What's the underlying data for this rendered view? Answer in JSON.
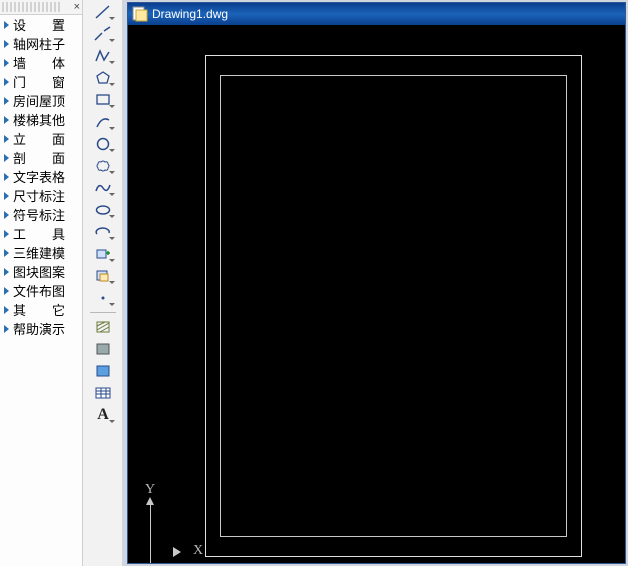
{
  "panel": {
    "items": [
      {
        "label": "设　　置"
      },
      {
        "label": "轴网柱子"
      },
      {
        "label": "墙　　体"
      },
      {
        "label": "门　　窗"
      },
      {
        "label": "房间屋顶"
      },
      {
        "label": "楼梯其他"
      },
      {
        "label": "立　　面"
      },
      {
        "label": "剖　　面"
      },
      {
        "label": "文字表格"
      },
      {
        "label": "尺寸标注"
      },
      {
        "label": "符号标注"
      },
      {
        "label": "工　　具"
      },
      {
        "label": "三维建模"
      },
      {
        "label": "图块图案"
      },
      {
        "label": "文件布图"
      },
      {
        "label": "其　　它"
      },
      {
        "label": "帮助演示"
      }
    ]
  },
  "toolbar": {
    "tools": [
      {
        "name": "line-tool",
        "drop": true
      },
      {
        "name": "construction-line-tool",
        "drop": true
      },
      {
        "name": "polyline-tool",
        "drop": true
      },
      {
        "name": "polygon-tool",
        "drop": true
      },
      {
        "name": "rectangle-tool",
        "drop": true
      },
      {
        "name": "arc-tool",
        "drop": true
      },
      {
        "name": "circle-tool",
        "drop": true
      },
      {
        "name": "revision-cloud-tool",
        "drop": true
      },
      {
        "name": "spline-tool",
        "drop": true
      },
      {
        "name": "ellipse-tool",
        "drop": true
      },
      {
        "name": "ellipse-arc-tool",
        "drop": true
      },
      {
        "name": "insert-block-tool",
        "drop": true
      },
      {
        "name": "make-block-tool",
        "drop": true
      },
      {
        "name": "point-tool",
        "drop": true
      },
      {
        "name": "hatch-tool",
        "drop": false
      },
      {
        "name": "gradient-tool",
        "drop": false
      },
      {
        "name": "region-tool",
        "drop": false
      },
      {
        "name": "table-tool",
        "drop": false
      },
      {
        "name": "text-tool",
        "drop": true
      }
    ]
  },
  "doc": {
    "title": "Drawing1.dwg",
    "axis_y": "Y",
    "axis_x": "X"
  }
}
